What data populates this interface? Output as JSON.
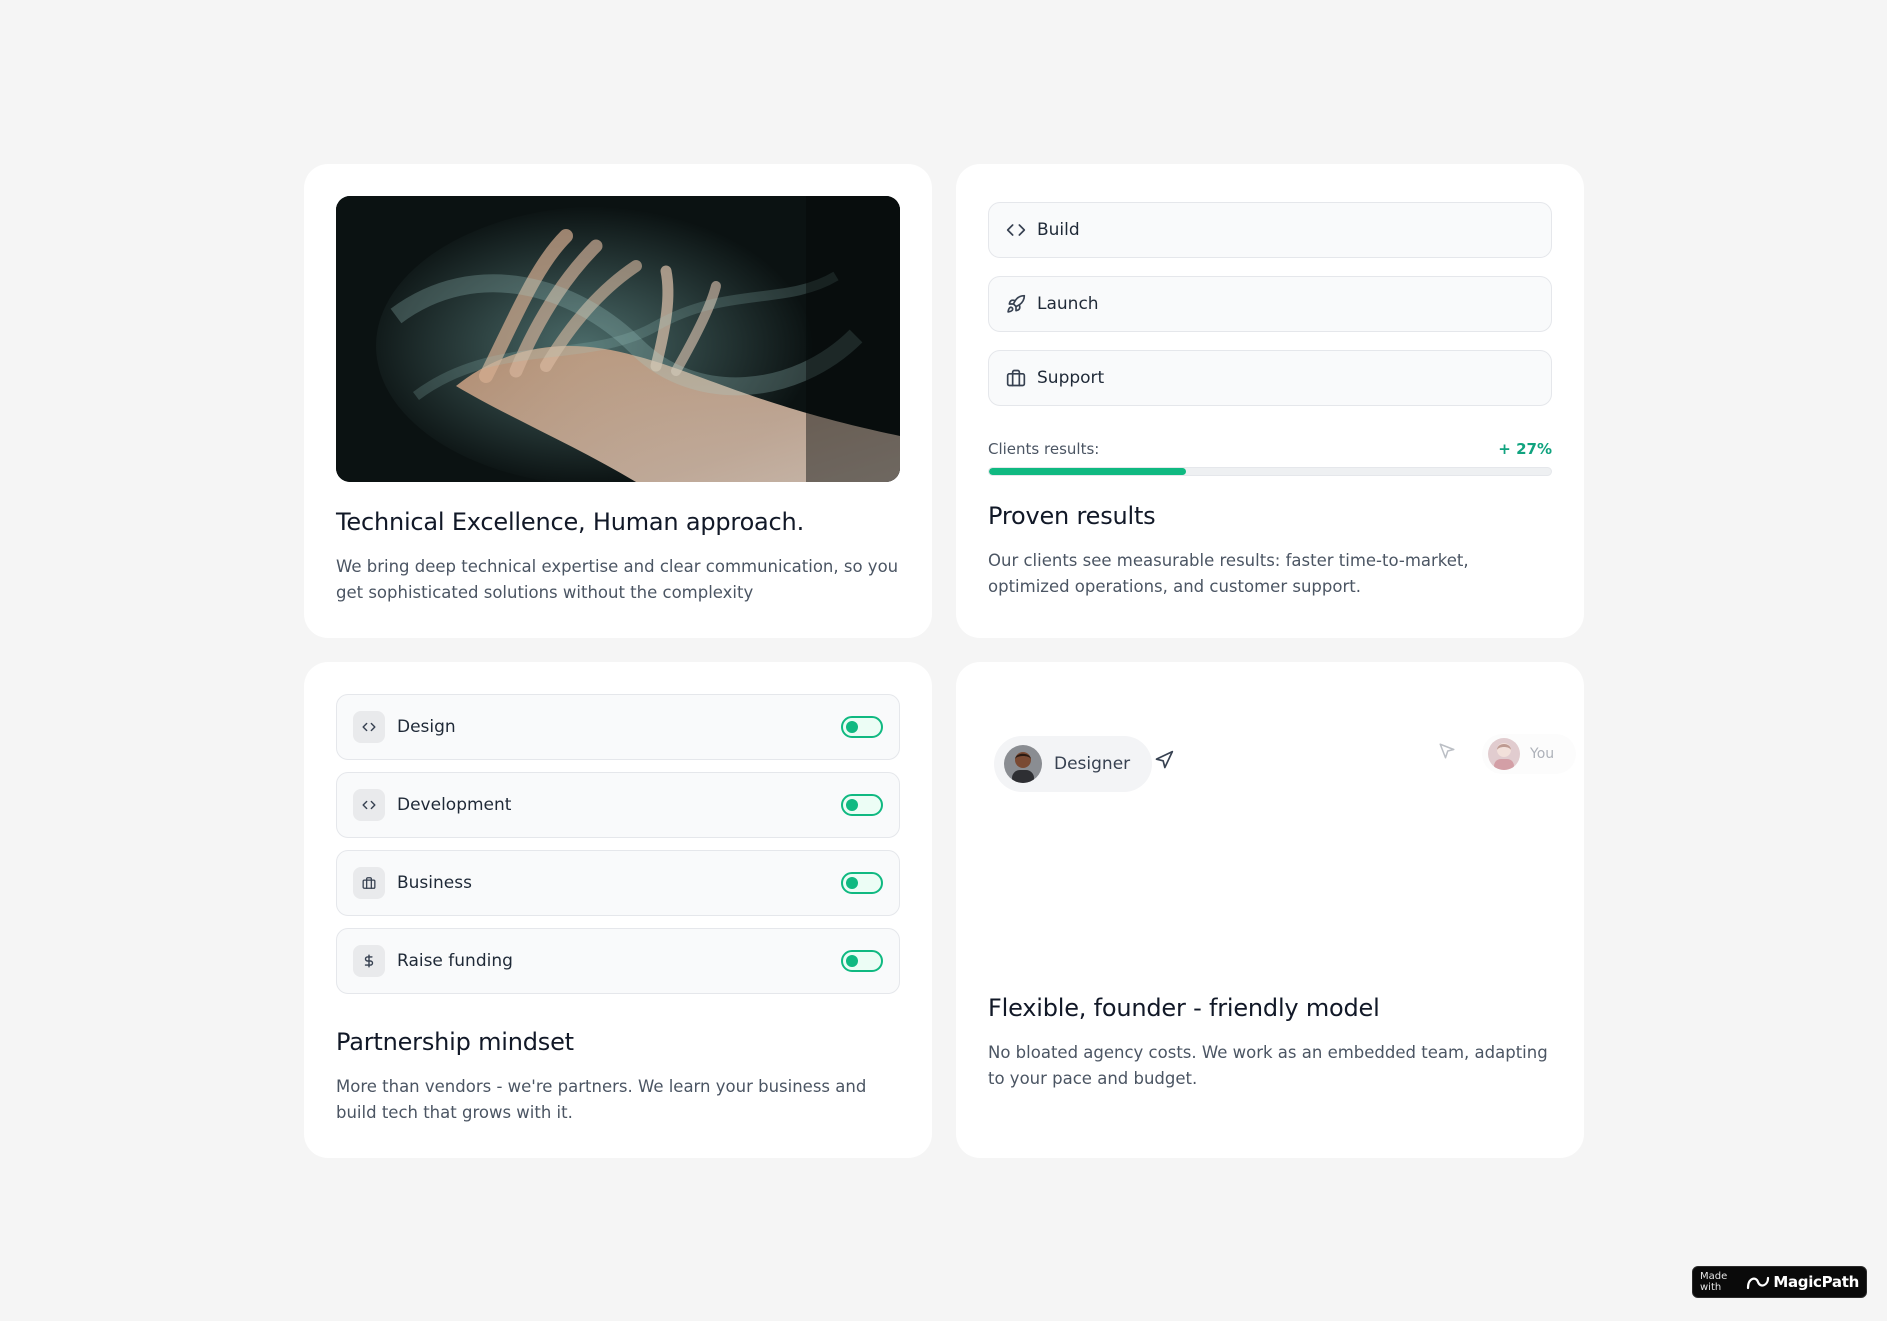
{
  "tech_card": {
    "title": "Technical Excellence, Human approach.",
    "text": "We bring deep technical expertise and clear communication, so you get sophisticated solutions without the complexity"
  },
  "results_card": {
    "steps": [
      {
        "label": "Build",
        "icon": "code-icon"
      },
      {
        "label": "Launch",
        "icon": "rocket-icon"
      },
      {
        "label": "Support",
        "icon": "briefcase-icon"
      }
    ],
    "progress_label": "Clients results:",
    "progress_value": "+ 27%",
    "progress_fraction": 0.35,
    "title": "Proven results",
    "text": "Our clients see measurable results: faster time-to-market, optimized operations, and customer support."
  },
  "partner_card": {
    "toggles": [
      {
        "label": "Design",
        "icon": "code-icon",
        "on": true
      },
      {
        "label": "Development",
        "icon": "code-icon",
        "on": true
      },
      {
        "label": "Business",
        "icon": "briefcase-icon",
        "on": true
      },
      {
        "label": "Raise funding",
        "icon": "dollar-icon",
        "on": true
      }
    ],
    "title": "Partnership mindset",
    "text": "More than vendors - we're partners. We learn your business and build tech that grows with it."
  },
  "flex_card": {
    "designer_label": "Designer",
    "you_label": "You",
    "title": "Flexible, founder - friendly model",
    "text": "No bloated agency costs. We work as an embedded team, adapting to your pace and budget."
  },
  "badge": {
    "made_with": "Made with",
    "brand": "MagicPath"
  },
  "colors": {
    "accent": "#10b981",
    "accent_text": "#10a37f",
    "background": "#f5f5f5",
    "card": "#ffffff"
  }
}
